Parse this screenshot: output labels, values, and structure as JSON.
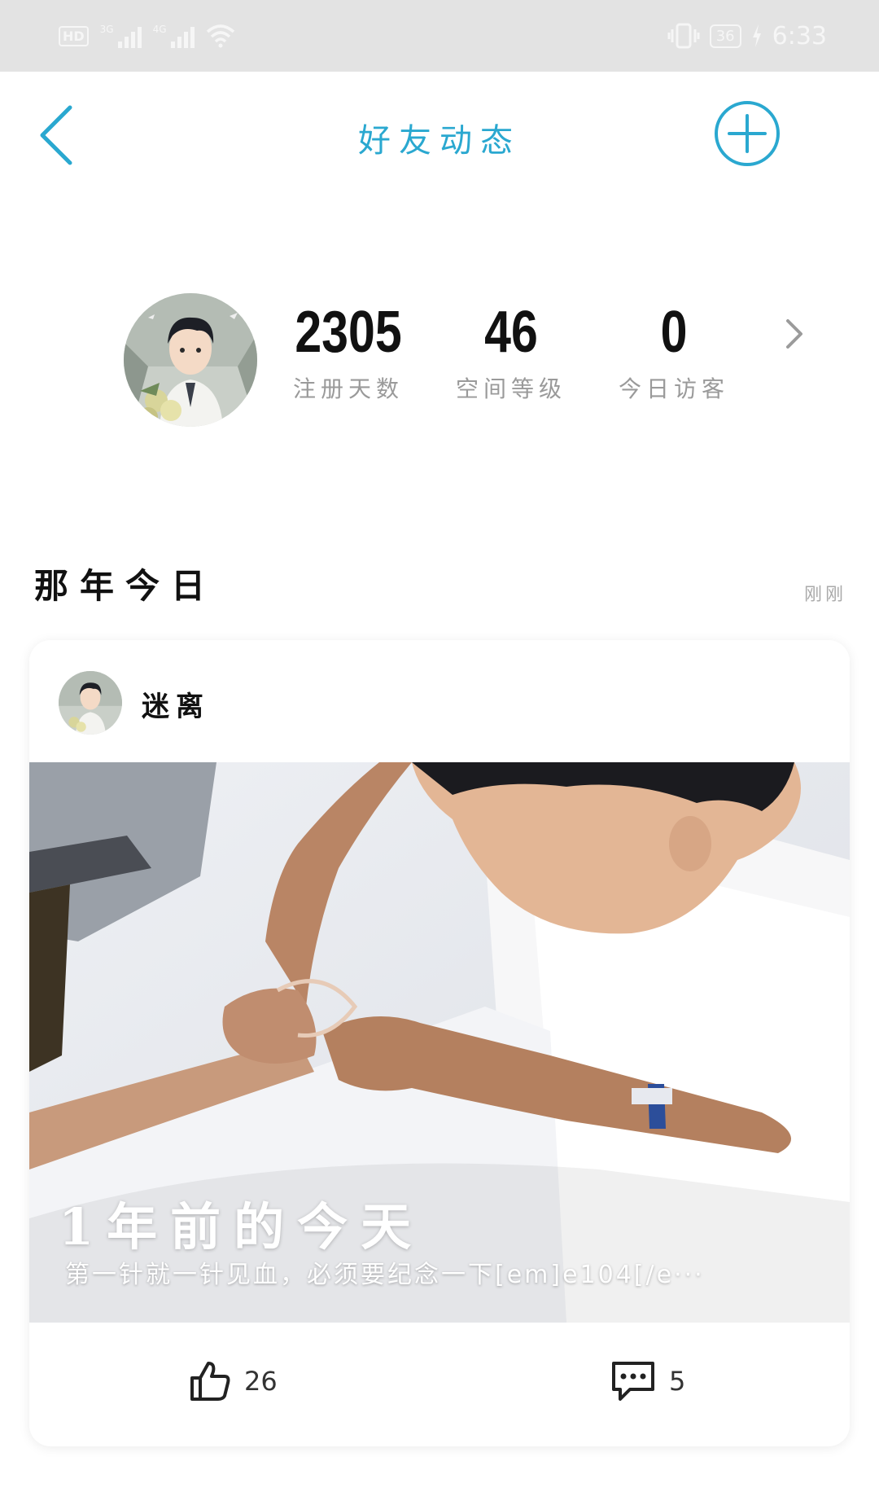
{
  "status_bar": {
    "left_badge": "HD",
    "net1": "3G",
    "net2": "4G",
    "battery": "36",
    "time": "6:33"
  },
  "header": {
    "title": "好友动态",
    "back_icon": "back-arrow-icon",
    "add_icon": "add-circle-icon"
  },
  "profile": {
    "stats": [
      {
        "value": "2305",
        "label": "注册天数"
      },
      {
        "value": "46",
        "label": "空间等级"
      },
      {
        "value": "0",
        "label": "今日访客"
      }
    ]
  },
  "memory": {
    "title": "那年今日",
    "time": "刚刚",
    "post": {
      "username": "迷离",
      "photo_title": "1年前的今天",
      "photo_caption": "第一针就一针见血，必须要纪念一下[em]e104[/e···",
      "likes": "26",
      "comments": "5"
    }
  },
  "colors": {
    "accent": "#2aa8d0",
    "statusbar": "#e3e3e3",
    "muted": "#9a9a9a"
  }
}
